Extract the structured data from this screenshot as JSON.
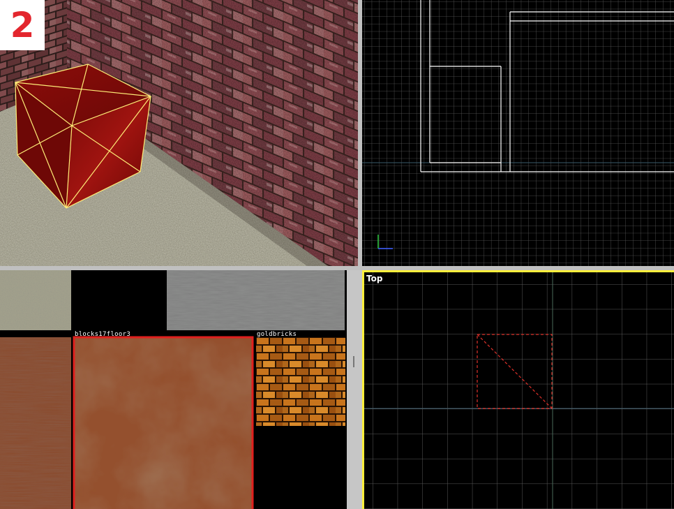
{
  "app": {
    "screenshot_badge": "2",
    "badge_color": "#e3262e"
  },
  "viewports": {
    "perspective": {
      "kind": "3D textured view",
      "selection_color": "#ffee77"
    },
    "side": {
      "kind": "2D grid view",
      "grid_color": "#5a5a5a",
      "brush_color": "#ffffff"
    },
    "top": {
      "label": "Top",
      "grid_color": "#5a5a5a",
      "selection_color": "#e0322b",
      "active_border_color": "#ffef3a"
    }
  },
  "texture_browser": {
    "textures": [
      {
        "name": "",
        "icon": "concrete-floor-texture"
      },
      {
        "name": "",
        "icon": "grey-concrete-texture"
      },
      {
        "name": "",
        "icon": "rusty-metal-texture"
      },
      {
        "name": "blocks17floor3",
        "icon": "rusty-metal-texture",
        "selected": true
      },
      {
        "name": "goldbricks",
        "icon": "gold-brick-texture"
      }
    ],
    "selected_border_color": "#e0201e"
  }
}
